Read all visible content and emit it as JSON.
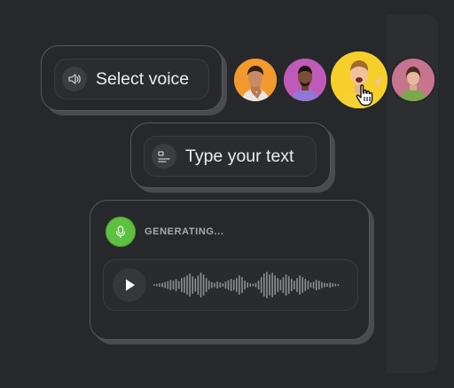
{
  "voice_selector": {
    "label": "Select voice",
    "icon": "speaker-icon"
  },
  "text_input": {
    "placeholder": "Type your text",
    "icon": "text-lines-icon"
  },
  "avatars": [
    {
      "name": "avatar-man-orange",
      "bg": "#f29a2e"
    },
    {
      "name": "avatar-man-purple",
      "bg": "#c05ab8"
    },
    {
      "name": "avatar-man-yellow-selected",
      "bg": "#f6cf2a"
    },
    {
      "name": "avatar-woman-green",
      "bg": "#c7748f"
    }
  ],
  "generator": {
    "status": "GENERATING...",
    "mic_color": "#5ec03f",
    "play_icon": "play-icon"
  },
  "waveform": {
    "bars": [
      2,
      3,
      4,
      5,
      7,
      9,
      12,
      10,
      14,
      9,
      16,
      18,
      22,
      26,
      20,
      15,
      22,
      28,
      24,
      16,
      10,
      7,
      5,
      8,
      6,
      4,
      8,
      11,
      14,
      12,
      16,
      22,
      18,
      10,
      6,
      4,
      3,
      5,
      10,
      18,
      26,
      30,
      24,
      28,
      22,
      16,
      12,
      18,
      24,
      20,
      14,
      10,
      16,
      22,
      18,
      14,
      10,
      6,
      8,
      12,
      10,
      7,
      5,
      4,
      6,
      4,
      3,
      2
    ]
  }
}
